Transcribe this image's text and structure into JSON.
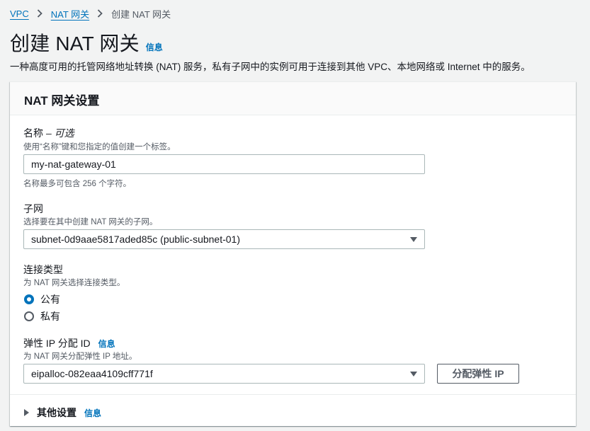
{
  "breadcrumb": {
    "items": [
      "VPC",
      "NAT 网关"
    ],
    "current": "创建 NAT 网关"
  },
  "page": {
    "title": "创建 NAT 网关",
    "info": "信息",
    "description": "一种高度可用的托管网络地址转换 (NAT) 服务，私有子网中的实例可用于连接到其他 VPC、本地网络或 Internet 中的服务。"
  },
  "panel": {
    "title": "NAT 网关设置"
  },
  "name_field": {
    "label": "名称",
    "optional": "– 可选",
    "description": "使用“名称”键和您指定的值创建一个标签。",
    "value": "my-nat-gateway-01",
    "constraint": "名称最多可包含 256 个字符。"
  },
  "subnet_field": {
    "label": "子网",
    "description": "选择要在其中创建 NAT 网关的子网。",
    "selected": "subnet-0d9aae5817aded85c (public-subnet-01)"
  },
  "connectivity": {
    "label": "连接类型",
    "description": "为 NAT 网关选择连接类型。",
    "options": [
      {
        "label": "公有",
        "checked": true
      },
      {
        "label": "私有",
        "checked": false
      }
    ]
  },
  "eip_field": {
    "label": "弹性 IP 分配 ID",
    "info": "信息",
    "description": "为 NAT 网关分配弹性 IP 地址。",
    "selected": "eipalloc-082eaa4109cff771f",
    "allocate_button": "分配弹性 IP"
  },
  "additional": {
    "label": "其他设置",
    "info": "信息"
  },
  "colors": {
    "link": "#0073bb",
    "text": "#16191f",
    "muted": "#545b64",
    "background": "#f2f3f3"
  }
}
